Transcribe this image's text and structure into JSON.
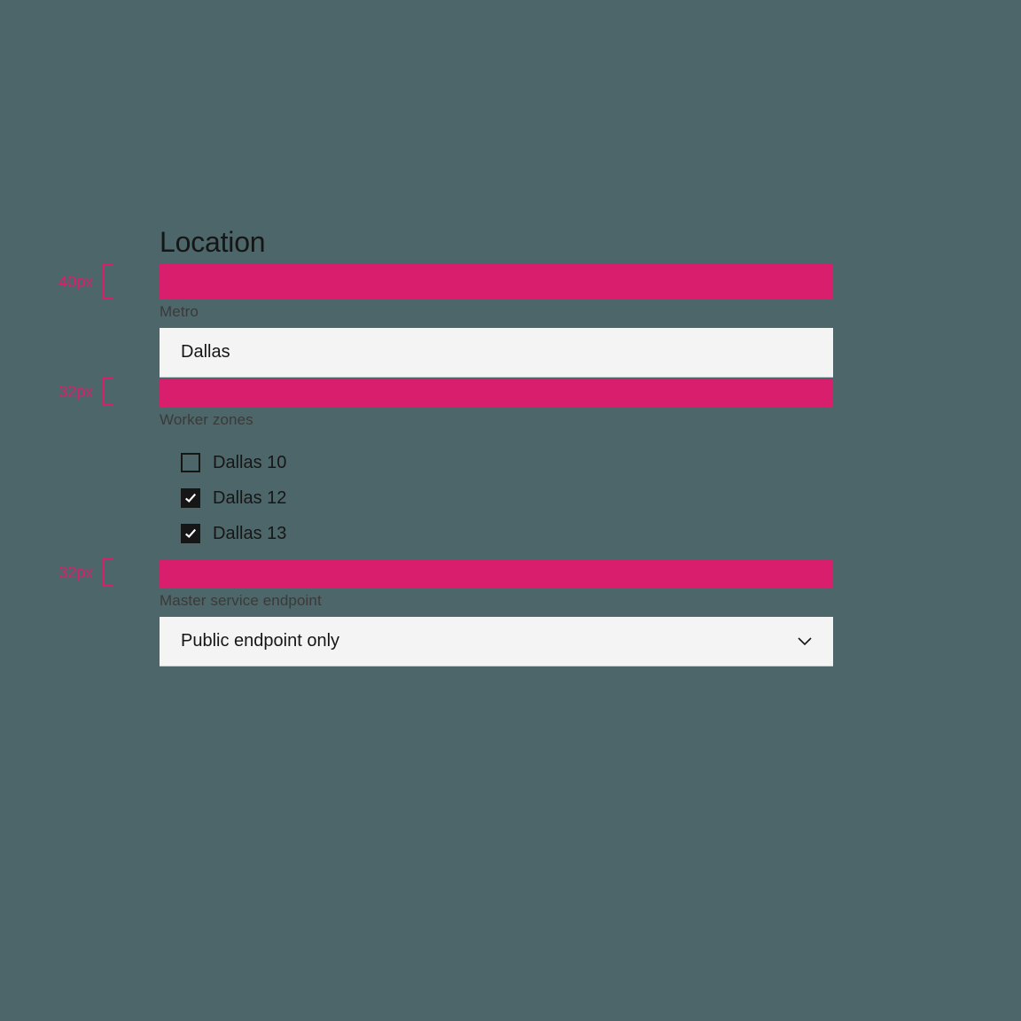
{
  "section_title": "Location",
  "spacers": {
    "a": "40px",
    "b": "32px",
    "c": "32px"
  },
  "metro": {
    "label": "Metro",
    "value": "Dallas"
  },
  "worker_zones": {
    "label": "Worker zones",
    "items": [
      {
        "label": "Dallas 10",
        "checked": false
      },
      {
        "label": "Dallas 12",
        "checked": true
      },
      {
        "label": "Dallas 13",
        "checked": true
      }
    ]
  },
  "master_endpoint": {
    "label": "Master service endpoint",
    "value": "Public endpoint only"
  },
  "colors": {
    "accent": "#d91e6e",
    "bg": "#4d6669",
    "field_bg": "#f4f4f4",
    "text": "#161616"
  }
}
